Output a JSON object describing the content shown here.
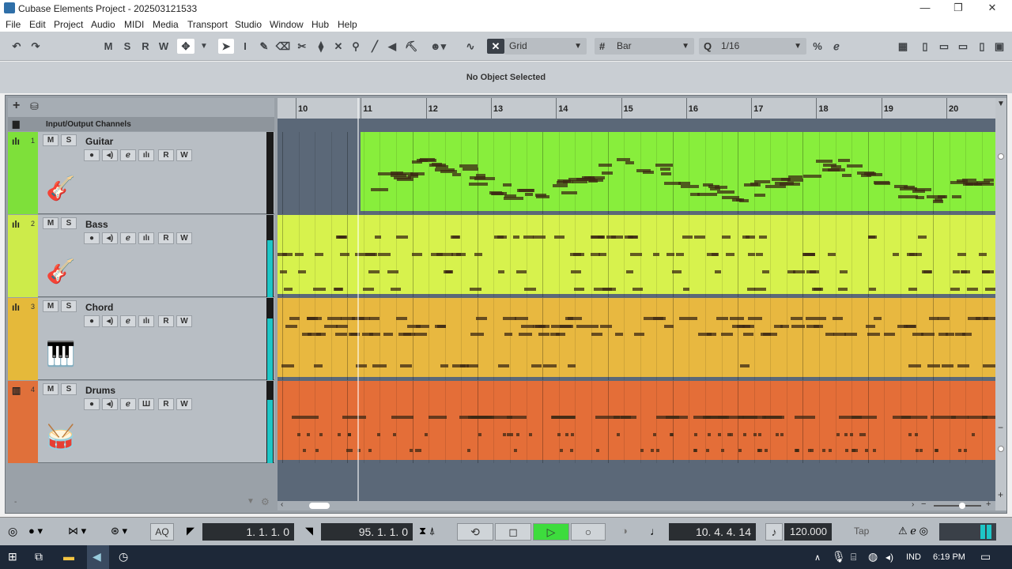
{
  "app": {
    "title": "Cubase Elements Project - 202503121533"
  },
  "window_controls": {
    "minimize": "—",
    "maximize": "❐",
    "close": "✕"
  },
  "menu": [
    "File",
    "Edit",
    "Project",
    "Audio",
    "MIDI",
    "Media",
    "Transport",
    "Studio",
    "Window",
    "Hub",
    "Help"
  ],
  "toolbar": {
    "undo": "↶",
    "redo": "↷",
    "mode_buttons": [
      "M",
      "S",
      "R",
      "W"
    ],
    "snap_type": "Grid",
    "grid_type": "Bar",
    "quantize": "1/16"
  },
  "info_line": {
    "text": "No Object Selected"
  },
  "tracklist": {
    "io_header": "Input/Output Channels",
    "tracks": [
      {
        "num": "1",
        "name": "Guitar",
        "color": "#7ee03a",
        "lane_color": "#88ee3c",
        "icon": "guitar-icon",
        "glyph": "🎸",
        "mute": "M",
        "solo": "S",
        "read": "R",
        "write": "W"
      },
      {
        "num": "2",
        "name": "Bass",
        "color": "#cdeb4a",
        "lane_color": "#d7f24d",
        "icon": "bass-guitar-icon",
        "glyph": "🎸",
        "mute": "M",
        "solo": "S",
        "read": "R",
        "write": "W"
      },
      {
        "num": "3",
        "name": "Chord",
        "color": "#e5b93a",
        "lane_color": "#e8b840",
        "icon": "keyboard-icon",
        "glyph": "🎹",
        "mute": "M",
        "solo": "S",
        "read": "R",
        "write": "W"
      },
      {
        "num": "4",
        "name": "Drums",
        "color": "#e0703a",
        "lane_color": "#e46e38",
        "icon": "drum-kit-icon",
        "glyph": "🥁",
        "mute": "M",
        "solo": "S",
        "read": "R",
        "write": "W"
      }
    ]
  },
  "ruler": {
    "bars": [
      "10",
      "11",
      "12",
      "13",
      "14",
      "15",
      "16",
      "17",
      "18",
      "19",
      "20"
    ]
  },
  "transport": {
    "left_locator": "1. 1. 1.  0",
    "right_locator": "95. 1. 1.  0",
    "position": "10. 4. 4. 14",
    "tempo": "120.000",
    "tap": "Tap",
    "aq": "AQ"
  },
  "taskbar": {
    "language": "IND",
    "time": "6:19 PM"
  }
}
